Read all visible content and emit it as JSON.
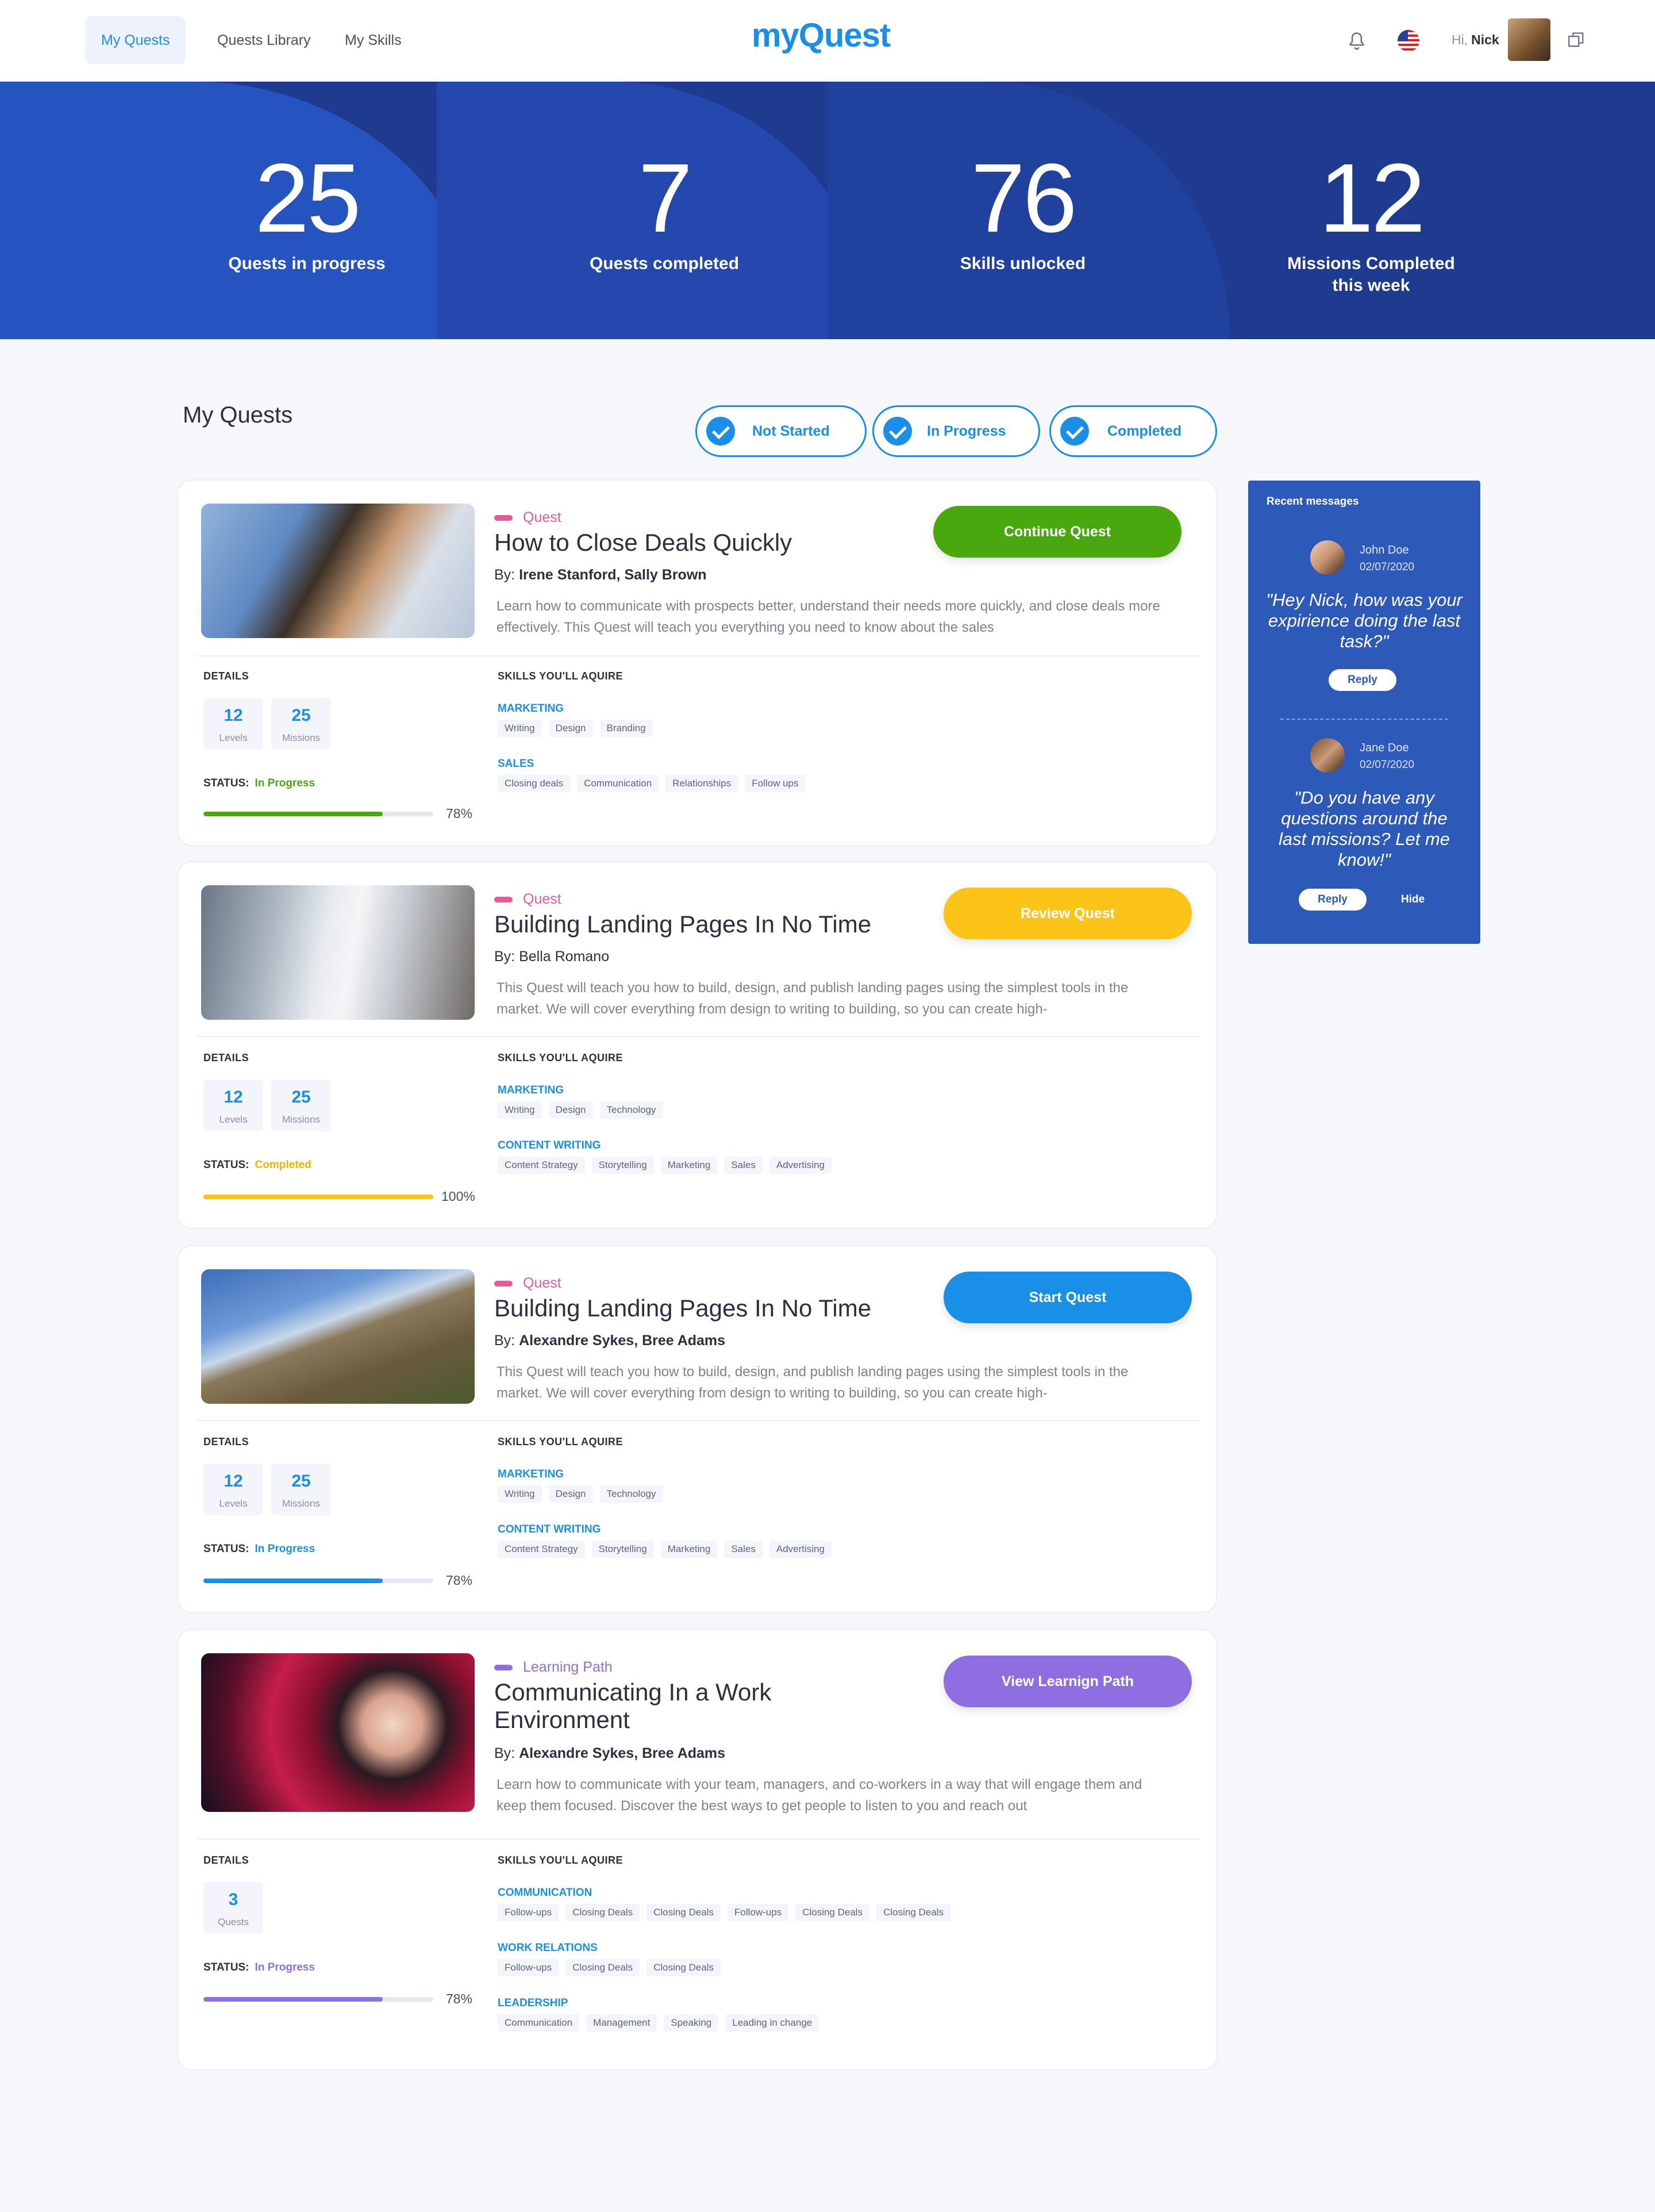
{
  "nav": {
    "tabs": [
      "My Quests",
      "Quests Library",
      "My Skills"
    ],
    "logo": "myQuest",
    "greeting": "Hi,",
    "user_name": "Nick",
    "icons": [
      "bell-icon",
      "us-flag-icon",
      "user-avatar",
      "window-switch-icon"
    ]
  },
  "stats": [
    {
      "value": "25",
      "label": "Quests in progress"
    },
    {
      "value": "7",
      "label": "Quests completed"
    },
    {
      "value": "76",
      "label": "Skills unlocked"
    },
    {
      "value": "12",
      "label": "Missions Completed this week"
    }
  ],
  "section_title": "My Quests",
  "filters": [
    "Not Started",
    "In Progress",
    "Completed"
  ],
  "labels": {
    "details": "DETAILS",
    "skills": "SKILLS YOU'LL AQUIRE",
    "status": "STATUS:",
    "levels": "Levels",
    "missions": "Missions",
    "quests": "Quests"
  },
  "colors": {
    "primary": "#1a8fe8",
    "green": "#4aa80f",
    "yellow": "#fcc419",
    "purple": "#8e6ee0",
    "quest_tag": "#e45b9a",
    "hero_dark": "#1e3b8f",
    "messages_bg": "#2d59b8"
  },
  "cards": [
    {
      "tag": "Quest",
      "title": "How to Close Deals Quickly",
      "by_prefix": "By:",
      "authors": "Irene Stanford, Sally Brown",
      "description": "Learn how to communicate with prospects better, understand their needs more quickly, and close deals more effectively. This Quest will teach you everything you need to know about the sales",
      "cta": "Continue Quest",
      "levels": "12",
      "missions": "25",
      "status": "In Progress",
      "progress": 0.78,
      "progress_label": "78%",
      "skills": [
        {
          "name": "MARKETING",
          "items": [
            "Writing",
            "Design",
            "Branding"
          ]
        },
        {
          "name": "SALES",
          "items": [
            "Closing deals",
            "Communication",
            "Relationships",
            "Follow ups"
          ]
        }
      ]
    },
    {
      "tag": "Quest",
      "title": "Building Landing Pages In No Time",
      "by_prefix": "By:",
      "authors": "Bella Romano",
      "description": "This Quest will teach you how to build, design, and publish landing pages using the simplest tools in the market. We will cover everything from design to writing to building, so you can create high-",
      "cta": "Review Quest",
      "levels": "12",
      "missions": "25",
      "status": "Completed",
      "progress": 1.0,
      "progress_label": "100%",
      "skills": [
        {
          "name": "MARKETING",
          "items": [
            "Writing",
            "Design",
            "Technology"
          ]
        },
        {
          "name": "CONTENT WRITING",
          "items": [
            "Content Strategy",
            "Storytelling",
            "Marketing",
            "Sales",
            "Advertising"
          ]
        }
      ]
    },
    {
      "tag": "Quest",
      "title": "Building Landing Pages In No Time",
      "by_prefix": "By:",
      "authors": "Alexandre Sykes, Bree Adams",
      "description": "This Quest will teach you how to build, design, and publish landing pages using the simplest tools in the market. We will cover everything from design to writing to building, so you can create high-",
      "cta": "Start Quest",
      "levels": "12",
      "missions": "25",
      "status": "In Progress",
      "progress": 0.78,
      "progress_label": "78%",
      "skills": [
        {
          "name": "MARKETING",
          "items": [
            "Writing",
            "Design",
            "Technology"
          ]
        },
        {
          "name": "CONTENT WRITING",
          "items": [
            "Content Strategy",
            "Storytelling",
            "Marketing",
            "Sales",
            "Advertising"
          ]
        }
      ]
    },
    {
      "tag": "Learning Path",
      "title": "Communicating In a Work Environment",
      "by_prefix": "By:",
      "authors": "Alexandre Sykes, Bree Adams",
      "description": "Learn how to communicate with your team, managers, and co-workers in a way that will engage them and keep them focused. Discover the best ways to get people to listen to you and reach out",
      "cta": "View Learnign Path",
      "quests": "3",
      "status": "In Progress",
      "progress": 0.78,
      "progress_label": "78%",
      "skills": [
        {
          "name": "COMMUNICATION",
          "items": [
            "Follow-ups",
            "Closing Deals",
            "Closing Deals",
            "Follow-ups",
            "Closing Deals",
            "Closing Deals"
          ]
        },
        {
          "name": "WORK RELATIONS",
          "items": [
            "Follow-ups",
            "Closing Deals",
            "Closing Deals"
          ]
        },
        {
          "name": "LEADERSHIP",
          "items": [
            "Communication",
            "Management",
            "Speaking",
            "Leading in change"
          ]
        }
      ]
    }
  ],
  "messages": {
    "title": "Recent messages",
    "items": [
      {
        "name": "John Doe",
        "date": "02/07/2020",
        "text": "\"Hey Nick, how was your expirience doing the last task?\"",
        "reply": "Reply"
      },
      {
        "name": "Jane Doe",
        "date": "02/07/2020",
        "text": "\"Do you have any questions around the last missions? Let me know!\"",
        "reply": "Reply",
        "hide": "Hide"
      }
    ]
  }
}
